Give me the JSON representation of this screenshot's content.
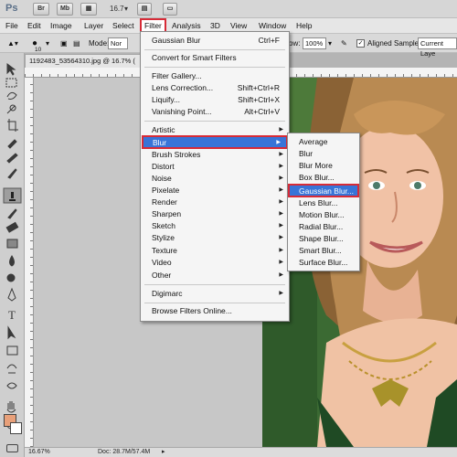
{
  "app": {
    "logo": "Ps",
    "buttons": [
      "Br",
      "Mb"
    ],
    "zoom_value": "16.7"
  },
  "menubar": {
    "items": [
      "File",
      "Edit",
      "Image",
      "Layer",
      "Select",
      "Filter",
      "Analysis",
      "3D",
      "View",
      "Window",
      "Help"
    ],
    "active": "Filter"
  },
  "options": {
    "brush_size": "10",
    "mode_label": "Mode:",
    "mode_value": "Nor",
    "flow_label": "ow:",
    "flow_value": "100%",
    "aligned_label": "Aligned",
    "sample_label": "Sample:",
    "sample_value": "Current Laye"
  },
  "document": {
    "tab_title": "1192483_53564310.jpg @ 16.7% (",
    "status_zoom": "16.67%",
    "status_doc": "Doc: 28.7M/57.4M"
  },
  "filter_menu": {
    "items": [
      {
        "label": "Gaussian Blur",
        "shortcut": "Ctrl+F"
      },
      {
        "label": "Convert for Smart Filters"
      },
      {
        "label": "Filter Gallery..."
      },
      {
        "label": "Lens Correction...",
        "shortcut": "Shift+Ctrl+R"
      },
      {
        "label": "Liquify...",
        "shortcut": "Shift+Ctrl+X"
      },
      {
        "label": "Vanishing Point...",
        "shortcut": "Alt+Ctrl+V"
      },
      {
        "label": "Artistic"
      },
      {
        "label": "Blur",
        "highlighted": true
      },
      {
        "label": "Brush Strokes"
      },
      {
        "label": "Distort"
      },
      {
        "label": "Noise"
      },
      {
        "label": "Pixelate"
      },
      {
        "label": "Render"
      },
      {
        "label": "Sharpen"
      },
      {
        "label": "Sketch"
      },
      {
        "label": "Stylize"
      },
      {
        "label": "Texture"
      },
      {
        "label": "Video"
      },
      {
        "label": "Other"
      },
      {
        "label": "Digimarc"
      },
      {
        "label": "Browse Filters Online..."
      }
    ]
  },
  "blur_submenu": {
    "items": [
      {
        "label": "Average"
      },
      {
        "label": "Blur"
      },
      {
        "label": "Blur More"
      },
      {
        "label": "Box Blur..."
      },
      {
        "label": "Gaussian Blur...",
        "highlighted": true
      },
      {
        "label": "Lens Blur..."
      },
      {
        "label": "Motion Blur..."
      },
      {
        "label": "Radial Blur..."
      },
      {
        "label": "Shape Blur..."
      },
      {
        "label": "Smart Blur..."
      },
      {
        "label": "Surface Blur..."
      }
    ]
  },
  "colors": {
    "highlight": "#3874d8",
    "annotation_outline": "#d72b37",
    "foreground_swatch": "#e8a07a",
    "background_swatch": "#ffffff"
  }
}
